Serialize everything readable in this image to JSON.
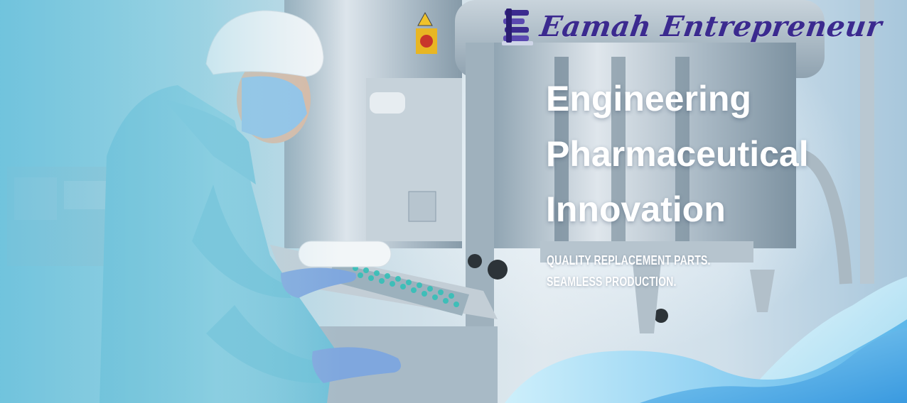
{
  "brand": {
    "name": "Eamah Entrepreneur",
    "logo_icon": "stacked-e-logo-icon",
    "color": "#3b2a8f"
  },
  "hero": {
    "headline": [
      "Engineering",
      "Pharmaceutical",
      "Innovation"
    ],
    "tagline": [
      "QUALITY REPLACEMENT PARTS.",
      "SEAMLESS PRODUCTION."
    ]
  },
  "colors": {
    "overlay_left": "#7fc6dc",
    "wave_light": "#cfeffa",
    "wave_mid": "#5fb8e8",
    "wave_dark": "#2f8fd6",
    "text": "#ffffff"
  }
}
